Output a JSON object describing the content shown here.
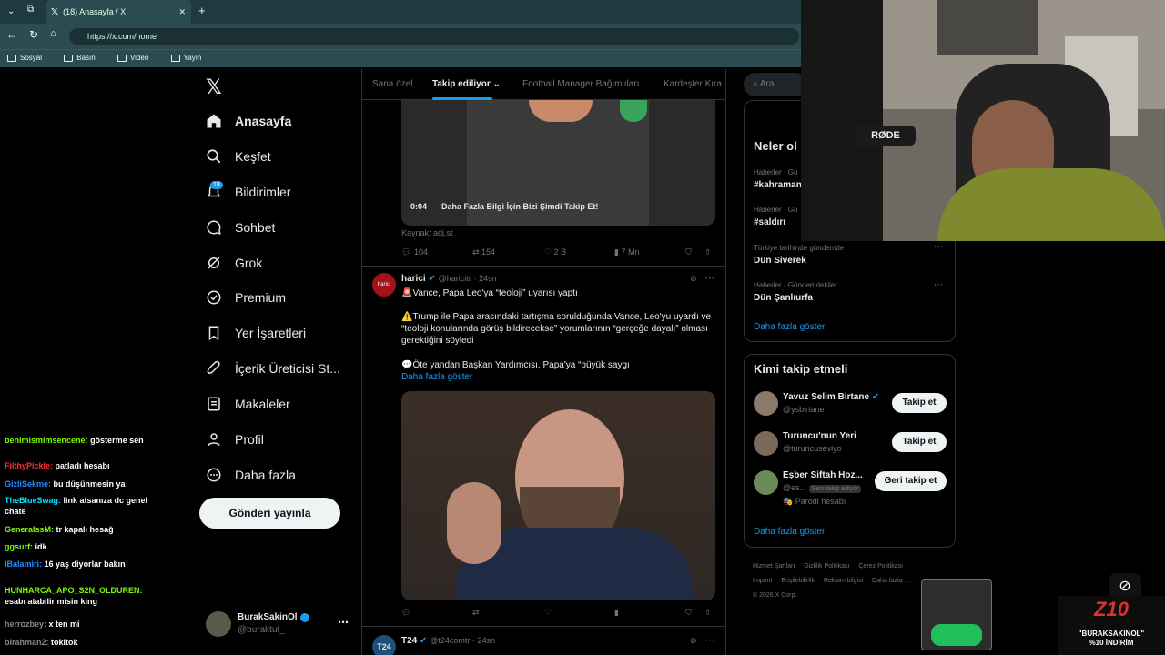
{
  "browser": {
    "tab_title": "(18) Anasayfa / X",
    "url": "https://x.com/home",
    "bookmarks": [
      "Sosyal",
      "Basın",
      "Video",
      "Yayın"
    ]
  },
  "nav": {
    "items": [
      "Anasayfa",
      "Keşfet",
      "Bildirimler",
      "Sohbet",
      "Grok",
      "Premium",
      "Yer İşaretleri",
      "İçerik Üreticisi St...",
      "Makaleler",
      "Profil",
      "Daha fazla"
    ],
    "notif_badge": "18",
    "post_button": "Gönderi yayınla",
    "account": {
      "name": "BurakSakinOl",
      "handle": "@buraktut_"
    }
  },
  "feed_tabs": [
    "Sana özel",
    "Takip ediliyor",
    "Football Manager Bağımlıları",
    "Kardeşler Kıra"
  ],
  "tweet1": {
    "video_time": "0:04",
    "video_caption": "Daha Fazla Bilgi İçin Bizi Şimdi Takip Et!",
    "source": "Kaynak: adj.st",
    "replies": "104",
    "reposts": "154",
    "likes": "2 B",
    "views": "7 Mn"
  },
  "tweet2": {
    "name": "harici",
    "handle": "@haricitr",
    "time": "24sn",
    "line1": "🚨Vance, Papa Leo'ya “teoloji” uyarısı yaptı",
    "line2": "⚠️Trump ile Papa arasındaki tartışma sorulduğunda Vance, Leo'yu uyardı ve “teoloji konularında görüş bildirecekse” yorumlarının “gerçeğe dayalı” olması gerektiğini söyledi",
    "line3": "💬Öte yandan Başkan Yardımcısı, Papa'ya “büyük saygı",
    "more": "Daha fazla göster"
  },
  "tweet3": {
    "avatar": "T24",
    "name": "T24",
    "handle": "@t24comtr",
    "time": "24sn"
  },
  "search_placeholder": "Ara",
  "trends": {
    "title": "Neler ol",
    "items": [
      {
        "cat": "Haberler · Gü",
        "name": "#kahraman"
      },
      {
        "cat": "Haberler · Gü",
        "name": "#saldırı"
      },
      {
        "cat": "Türkiye tarihinde gündemde",
        "name": "Dün Siverek"
      },
      {
        "cat": "Haberler · Gündemdekiler",
        "name": "Dün Şanlıurfa"
      }
    ],
    "more": "Daha fazla göster"
  },
  "who": {
    "title": "Kimi takip etmeli",
    "users": [
      {
        "name": "Yavuz Selim Birtane",
        "handle": "@ysbirtane",
        "btn": "Takip et"
      },
      {
        "name": "Turuncu'nun Yeri",
        "handle": "@turuncuseviyo",
        "btn": "Takip et"
      },
      {
        "name": "Eşber Siftah Hoz...",
        "handle": "@es...",
        "badge": "Seni takip ediyor",
        "btn": "Geri takip et",
        "extra": "🎭 Parodi hesabı"
      }
    ],
    "more": "Daha fazla göster"
  },
  "footer": [
    "Hizmet Şartları",
    "Gizlilik Politikası",
    "Çerez Politikası",
    "Imprint",
    "Erişilebilirlik",
    "Reklam bilgisi",
    "Daha fazla ...",
    "© 2026 X Corp."
  ],
  "chat": [
    {
      "user": "benimismimsencene:",
      "msg": "gösterme sen",
      "color": "#7cfc00"
    },
    {
      "user": "FilthyPickle:",
      "msg": "patladı hesabı",
      "color": "#ff3030"
    },
    {
      "user": "GizliSekme:",
      "msg": "bu düşünmesin ya",
      "color": "#1e90ff"
    },
    {
      "user": "TheBlueSwag:",
      "msg": "link atsanıza dc genel chate",
      "color": "#00e5ff"
    },
    {
      "user": "GeneralssM:",
      "msg": "tr kapalı hesağ",
      "color": "#7cfc00"
    },
    {
      "user": "ggsurf:",
      "msg": "idk",
      "color": "#7cfc00"
    },
    {
      "user": "IBalamiri:",
      "msg": "16 yaş diyorlar bakın",
      "color": "#1e90ff"
    },
    {
      "user": "HUNHARCA_APO_S2N_OLDUREN:",
      "msg": "esabı atabilir misin king",
      "color": "#7cfc00"
    },
    {
      "user": "herrozbey:",
      "msg": "x ten mi",
      "color": "#888"
    },
    {
      "user": "birahman2:",
      "msg": "tokitok",
      "color": "#888"
    }
  ],
  "promo": {
    "code": "Z10",
    "text1": "\"BURAKSAKINOL\"",
    "text2": "%10 İNDİRİM"
  },
  "webcam": {
    "mic_brand": "RØDE"
  }
}
